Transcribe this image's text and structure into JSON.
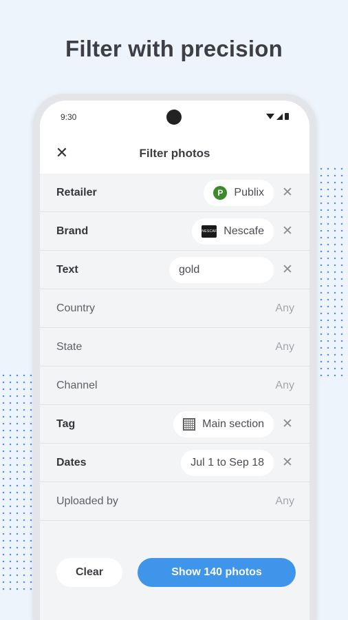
{
  "headline": "Filter with precision",
  "status_bar": {
    "time": "9:30"
  },
  "app_bar": {
    "title": "Filter photos",
    "close_icon": "close-icon"
  },
  "filters": {
    "retailer": {
      "label": "Retailer",
      "value": "Publix",
      "logo_letter": "P",
      "logo_color": "#3d8a2e"
    },
    "brand": {
      "label": "Brand",
      "value": "Nescafe",
      "logo_text": "NESCAFE"
    },
    "text": {
      "label": "Text",
      "value": "gold"
    },
    "country": {
      "label": "Country",
      "value": "Any"
    },
    "state": {
      "label": "State",
      "value": "Any"
    },
    "channel": {
      "label": "Channel",
      "value": "Any"
    },
    "tag": {
      "label": "Tag",
      "value": "Main section",
      "icon": "grid-icon"
    },
    "dates": {
      "label": "Dates",
      "value": "Jul 1 to Sep 18"
    },
    "uploaded_by": {
      "label": "Uploaded by",
      "value": "Any"
    }
  },
  "actions": {
    "clear_label": "Clear",
    "show_label": "Show 140 photos"
  },
  "colors": {
    "accent": "#3f95ea",
    "background": "#eef4fc"
  }
}
